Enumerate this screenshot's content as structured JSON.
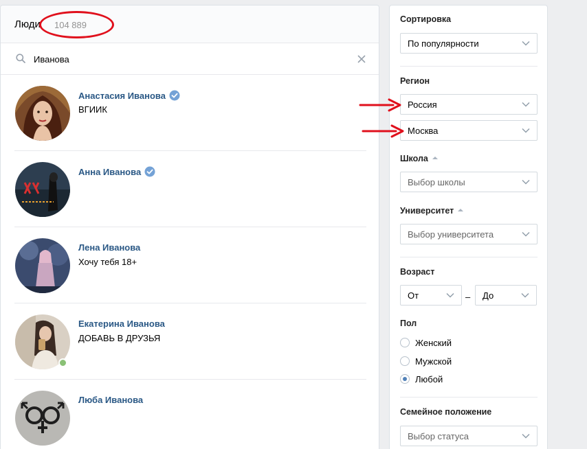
{
  "header": {
    "title": "Люди",
    "count": "104 889"
  },
  "search": {
    "value": "Иванова"
  },
  "people": [
    {
      "name": "Анастасия Иванова",
      "sub": "ВГИИК",
      "verified": true,
      "online": false
    },
    {
      "name": "Анна Иванова",
      "sub": "",
      "verified": true,
      "online": false
    },
    {
      "name": "Лена Иванова",
      "sub": "Хочу тебя 18+",
      "verified": false,
      "online": false
    },
    {
      "name": "Екатерина Иванова",
      "sub": "ДОБАВЬ В ДРУЗЬЯ",
      "verified": false,
      "online": true
    },
    {
      "name": "Люба Иванова",
      "sub": "",
      "verified": false,
      "online": false
    }
  ],
  "filters": {
    "sort": {
      "label": "Сортировка",
      "value": "По популярности"
    },
    "region": {
      "label": "Регион",
      "country": "Россия",
      "city": "Москва"
    },
    "school": {
      "label": "Школа",
      "placeholder": "Выбор школы"
    },
    "university": {
      "label": "Университет",
      "placeholder": "Выбор университета"
    },
    "age": {
      "label": "Возраст",
      "from": "От",
      "dash": "–",
      "to": "До"
    },
    "gender": {
      "label": "Пол",
      "options": [
        "Женский",
        "Мужской",
        "Любой"
      ],
      "selected": 2
    },
    "marital": {
      "label": "Семейное положение",
      "placeholder": "Выбор статуса"
    }
  },
  "colors": {
    "link": "#2a5885",
    "accent": "#5181b8",
    "online": "#8ac176",
    "annotation": "#e0101c"
  }
}
